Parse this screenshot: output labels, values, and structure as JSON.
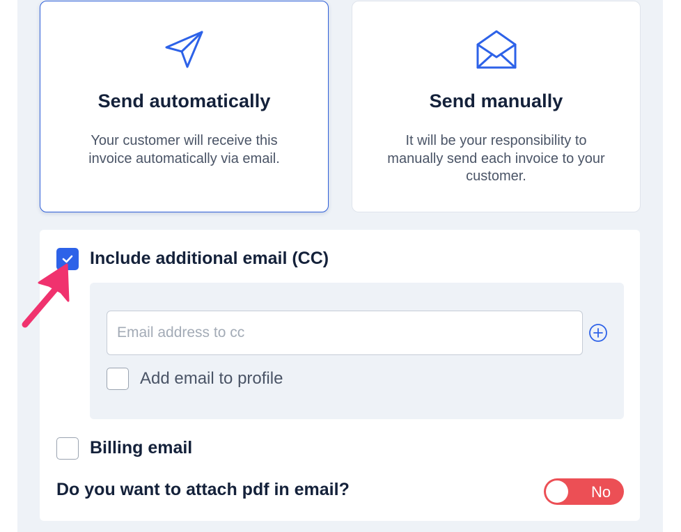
{
  "delivery_options": [
    {
      "icon": "paper-plane-icon",
      "title": "Send automatically",
      "description": "Your customer will receive this invoice automatically via email.",
      "selected": true
    },
    {
      "icon": "open-envelope-icon",
      "title": "Send manually",
      "description": "It will be your responsibility to manually send each invoice to your customer.",
      "selected": false
    }
  ],
  "options": {
    "cc": {
      "label": "Include additional email (CC)",
      "checked": true,
      "email_placeholder": "Email address to cc",
      "email_value": "",
      "add_icon": "plus-circle-icon",
      "add_to_profile_label": "Add email to profile",
      "add_to_profile_checked": false
    },
    "billing_email": {
      "label": "Billing email",
      "checked": false
    },
    "attach_pdf": {
      "question": "Do you want to attach pdf in email?",
      "toggle_label": "No",
      "enabled": false
    }
  },
  "colors": {
    "accent": "#2d62e8",
    "toggle_off": "#ec4f55",
    "annotation_arrow": "#f0326e"
  }
}
